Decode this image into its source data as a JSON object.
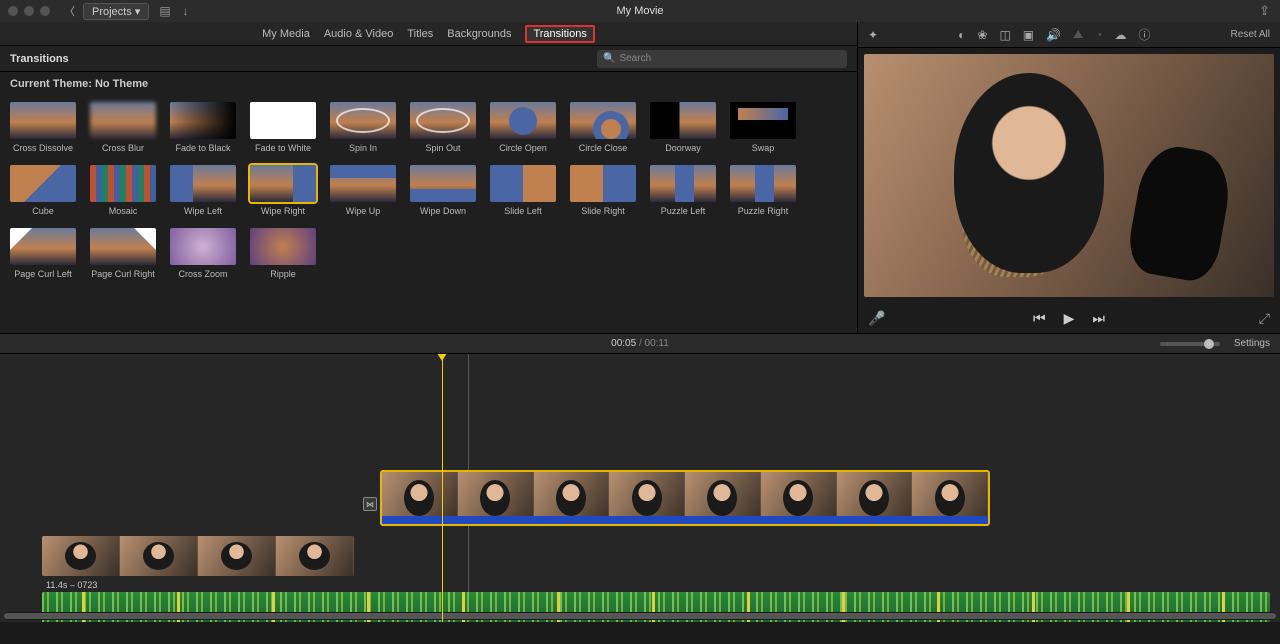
{
  "titlebar": {
    "projects_label": "Projects",
    "title": "My Movie"
  },
  "tabs": {
    "my_media": "My Media",
    "audio_video": "Audio & Video",
    "titles": "Titles",
    "backgrounds": "Backgrounds",
    "transitions": "Transitions"
  },
  "browser": {
    "header": "Transitions",
    "search_placeholder": "Search",
    "theme_label": "Current Theme: No Theme"
  },
  "transitions": [
    {
      "name": "Cross Dissolve",
      "v": ""
    },
    {
      "name": "Cross Blur",
      "v": "tv-cb"
    },
    {
      "name": "Fade to Black",
      "v": "tv-ftb"
    },
    {
      "name": "Fade to White",
      "v": "tv-ftw"
    },
    {
      "name": "Spin In",
      "v": "tv-spin"
    },
    {
      "name": "Spin Out",
      "v": "tv-spin"
    },
    {
      "name": "Circle Open",
      "v": "tv-co"
    },
    {
      "name": "Circle Close",
      "v": "tv-cc"
    },
    {
      "name": "Doorway",
      "v": "tv-dw"
    },
    {
      "name": "Swap",
      "v": "tv-sw"
    },
    {
      "name": "Cube",
      "v": "tv-cu"
    },
    {
      "name": "Mosaic",
      "v": "tv-mo"
    },
    {
      "name": "Wipe Left",
      "v": "tv-wl"
    },
    {
      "name": "Wipe Right",
      "v": "tv-wr",
      "selected": true
    },
    {
      "name": "Wipe Up",
      "v": "tv-wu"
    },
    {
      "name": "Wipe Down",
      "v": "tv-wd"
    },
    {
      "name": "Slide Left",
      "v": "tv-sl"
    },
    {
      "name": "Slide Right",
      "v": "tv-sr"
    },
    {
      "name": "Puzzle Left",
      "v": "tv-pz"
    },
    {
      "name": "Puzzle Right",
      "v": "tv-pz"
    },
    {
      "name": "Page Curl Left",
      "v": "tv-pc2"
    },
    {
      "name": "Page Curl Right",
      "v": "tv-pc"
    },
    {
      "name": "Cross Zoom",
      "v": "tv-cz"
    },
    {
      "name": "Ripple",
      "v": "tv-rp"
    }
  ],
  "viewer": {
    "reset_label": "Reset All"
  },
  "timeline": {
    "time_current": "00:05",
    "time_total": "00:11",
    "settings_label": "Settings",
    "audio_clip_label": "11.4s – 0723"
  }
}
